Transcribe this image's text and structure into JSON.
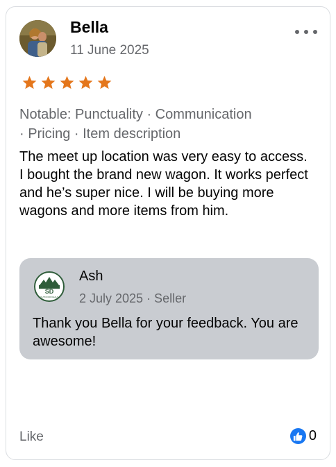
{
  "review": {
    "author_name": "Bella",
    "date": "11 June 2025",
    "rating": 5,
    "star_color": "#e4761b",
    "notable_line1": "Notable: Punctuality · Communication",
    "notable_line2": "· Pricing · Item description",
    "text": "The meet up location was very easy to access. I bought the brand new wagon. It works perfect and he’s super nice. I will be buying more wagons and more items from him."
  },
  "reply": {
    "author_name": "Ash",
    "meta": "2 July 2025 · Seller",
    "text": "Thank you Bella for your feedback. You are awesome!",
    "logo_text": "SD",
    "logo_subtext": "OUTDOOR DEALS"
  },
  "footer": {
    "like_label": "Like",
    "like_count": "0",
    "like_color": "#1877f2"
  },
  "icons": {
    "more": "more-horizontal-icon",
    "star": "star-icon",
    "like": "thumbs-up-icon"
  }
}
